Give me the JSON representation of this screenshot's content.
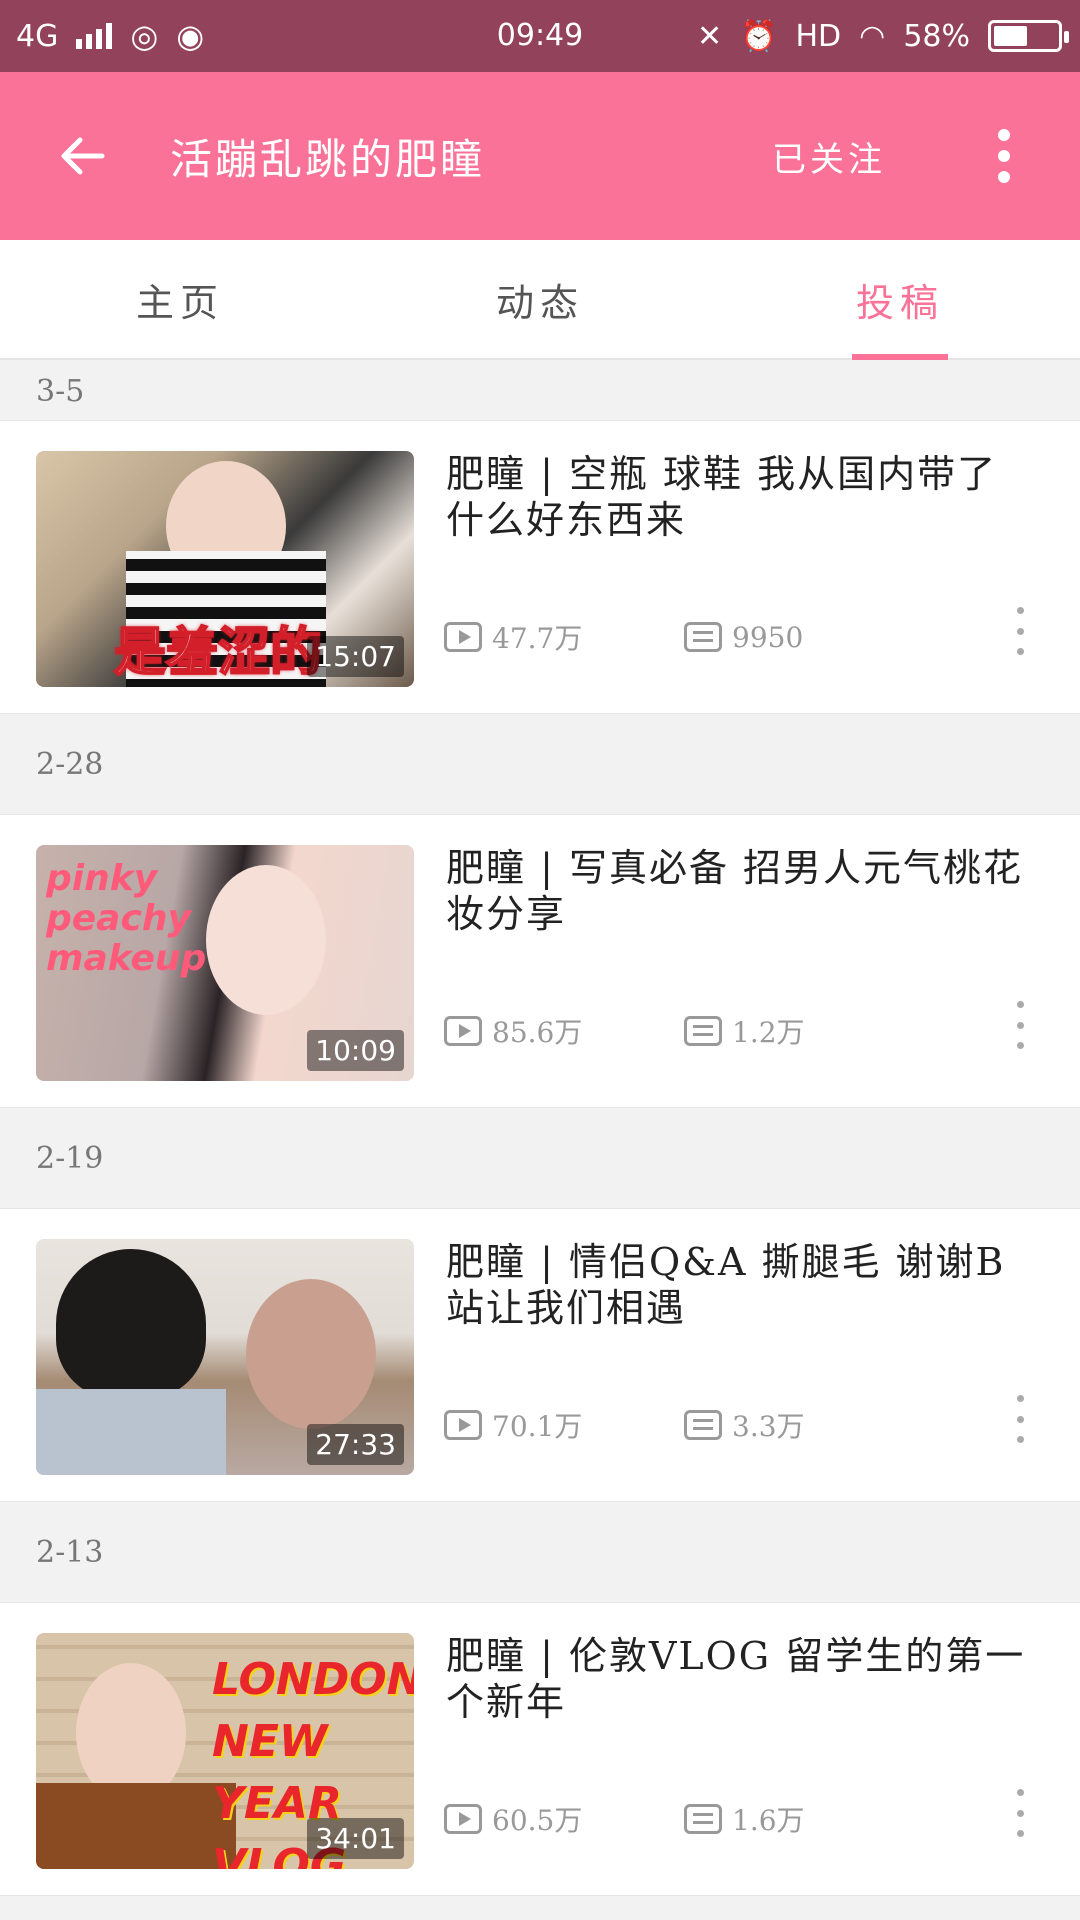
{
  "status_bar": {
    "network": "4G",
    "time": "09:49",
    "hd": "HD",
    "battery": "58%",
    "battery_level": 0.58
  },
  "app_bar": {
    "title": "活蹦乱跳的肥瞳",
    "follow_label": "已关注"
  },
  "tabs": [
    {
      "label": "主页",
      "active": false
    },
    {
      "label": "动态",
      "active": false
    },
    {
      "label": "投稿",
      "active": true
    }
  ],
  "videos": [
    {
      "date": "3-5",
      "title_line1": "肥瞳 | 空瓶 球鞋 我从国内带了",
      "title_line2": "什么好东西来",
      "duration": "15:07",
      "views": "47.7万",
      "danmaku": "9950",
      "thumb_text": "是羞涩的"
    },
    {
      "date": "2-28",
      "title_line1": "肥瞳 | 写真必备 招男人元气桃花",
      "title_line2": "妆分享",
      "duration": "10:09",
      "views": "85.6万",
      "danmaku": "1.2万",
      "thumb_text": "pinky peachy makeup"
    },
    {
      "date": "2-19",
      "title_line1": "肥瞳 | 情侣Q&A 撕腿毛 谢谢B",
      "title_line2": "站让我们相遇",
      "duration": "27:33",
      "views": "70.1万",
      "danmaku": "3.3万",
      "thumb_text": ""
    },
    {
      "date": "2-13",
      "title_line1": "肥瞳 | 伦敦VLOG 留学生的第一",
      "title_line2": "个新年",
      "duration": "34:01",
      "views": "60.5万",
      "danmaku": "1.6万",
      "thumb_text": "LONDON NEW YEAR VLOG"
    }
  ],
  "colors": {
    "status_bar": "#93425c",
    "app_bar": "#fb7299",
    "accent": "#fb7299"
  }
}
